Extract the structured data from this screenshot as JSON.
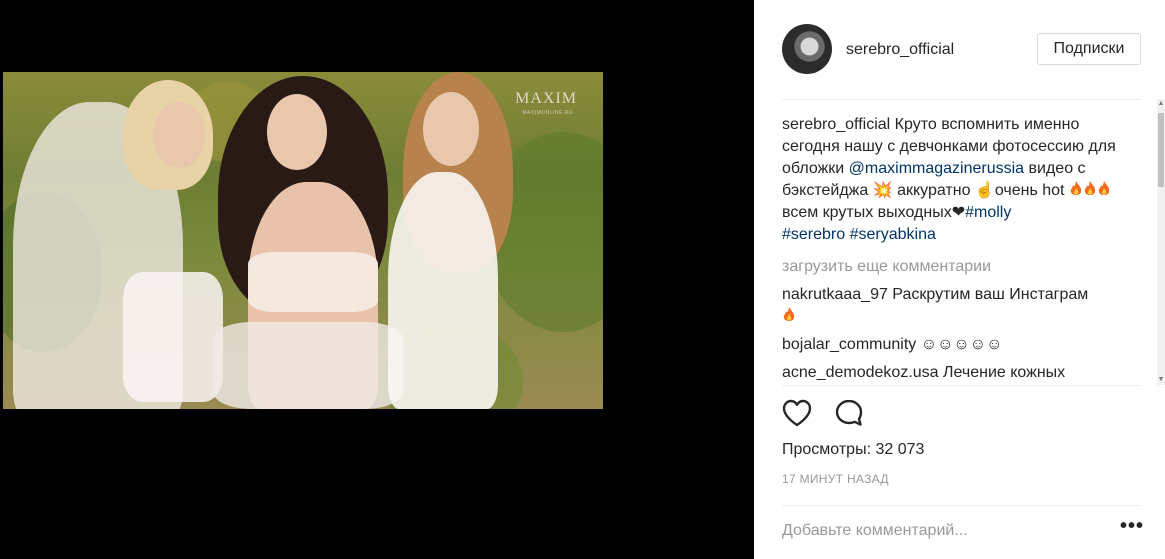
{
  "video": {
    "watermark": "MAXIM",
    "watermark_sub": "MAXIMONLINE.RU"
  },
  "post": {
    "username": "serebro_official",
    "follow_button": "Подписки",
    "caption": {
      "username": "serebro_official",
      "text_1": " Круто вспомнить именно сегодня нашу с девчонками фотосессию для обложки ",
      "mention": "@maximmagazinerussia",
      "text_2": " видео с бэкстейджа 💥 аккуратно ☝очень hot ",
      "text_3": " всем крутых выходных❤",
      "hashtag_1": "#molly",
      "hashtag_2": "#serebro",
      "hashtag_3": "#seryabkina"
    },
    "load_more": "загрузить еще комментарии",
    "comments": [
      {
        "username": "nakrutkaaa_97",
        "text": " Раскрутим ваш Инстаграм"
      },
      {
        "username": "bojalar_community",
        "text": " ☺☺☺☺☺"
      },
      {
        "username": "acne_demodekoz.usa",
        "text": " Лечение кожных"
      }
    ],
    "views": "Просмотры: 32 073",
    "time_ago": "17 МИНУТ НАЗАД",
    "comment_placeholder": "Добавьте комментарий...",
    "more_options": "•••"
  },
  "icons": {
    "like": "heart-icon",
    "comment": "speech-bubble-icon",
    "fire": "fire-emoji-icon"
  },
  "colors": {
    "link": "#003569",
    "muted": "#999999",
    "text": "#262626",
    "border": "#dbdbdb"
  }
}
